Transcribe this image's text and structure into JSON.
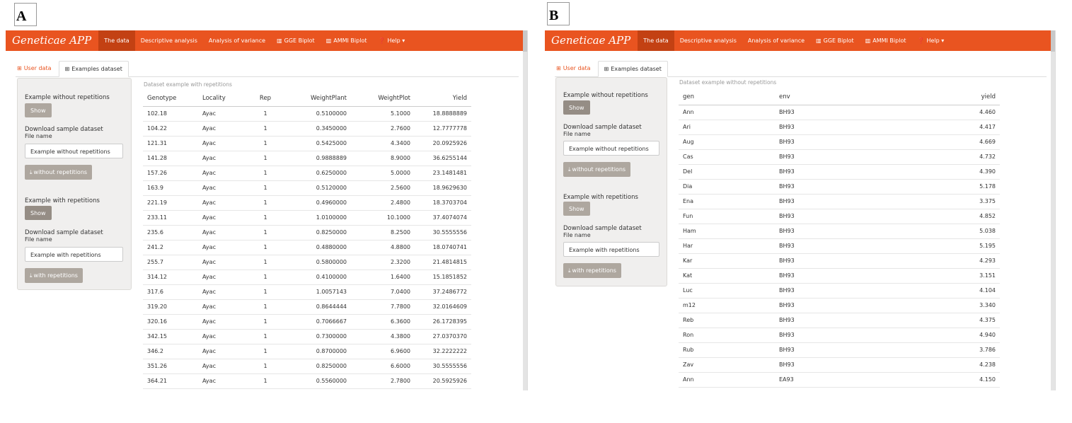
{
  "panel_a": {
    "label": "A",
    "navbar": {
      "brand": "Geneticae APP",
      "items": [
        {
          "label": "The data",
          "icon": ""
        },
        {
          "label": "Descriptive analysis",
          "icon": ""
        },
        {
          "label": "Analysis of variance",
          "icon": ""
        },
        {
          "label": "GGE Biplot",
          "icon": "chart-icon"
        },
        {
          "label": "AMMI Biplot",
          "icon": "chart-icon"
        },
        {
          "label": "Help ▾",
          "icon": "help-icon"
        }
      ]
    },
    "tabs": [
      {
        "label": "User data"
      },
      {
        "label": "Examples dataset"
      }
    ],
    "sidebar": {
      "example_without_label": "Example without repetitions",
      "show_without_label": "Show",
      "download_without_label": "Download sample dataset",
      "filename_without_label": "File name",
      "filename_without_value": "Example without repetitions",
      "download_without_button": "without repetitions",
      "example_with_label": "Example with repetitions",
      "show_with_label": "Show",
      "download_with_label": "Download sample dataset",
      "filename_with_label": "File name",
      "filename_with_value": "Example with repetitions",
      "download_with_button": "with repetitions"
    },
    "table": {
      "caption": "Dataset example with repetitions",
      "columns": [
        "Genotype",
        "Locality",
        "Rep",
        "WeightPlant",
        "WeightPlot",
        "Yield"
      ],
      "rows": [
        [
          "102.18",
          "Ayac",
          "1",
          "0.5100000",
          "5.1000",
          "18.8888889"
        ],
        [
          "104.22",
          "Ayac",
          "1",
          "0.3450000",
          "2.7600",
          "12.7777778"
        ],
        [
          "121.31",
          "Ayac",
          "1",
          "0.5425000",
          "4.3400",
          "20.0925926"
        ],
        [
          "141.28",
          "Ayac",
          "1",
          "0.9888889",
          "8.9000",
          "36.6255144"
        ],
        [
          "157.26",
          "Ayac",
          "1",
          "0.6250000",
          "5.0000",
          "23.1481481"
        ],
        [
          "163.9",
          "Ayac",
          "1",
          "0.5120000",
          "2.5600",
          "18.9629630"
        ],
        [
          "221.19",
          "Ayac",
          "1",
          "0.4960000",
          "2.4800",
          "18.3703704"
        ],
        [
          "233.11",
          "Ayac",
          "1",
          "1.0100000",
          "10.1000",
          "37.4074074"
        ],
        [
          "235.6",
          "Ayac",
          "1",
          "0.8250000",
          "8.2500",
          "30.5555556"
        ],
        [
          "241.2",
          "Ayac",
          "1",
          "0.4880000",
          "4.8800",
          "18.0740741"
        ],
        [
          "255.7",
          "Ayac",
          "1",
          "0.5800000",
          "2.3200",
          "21.4814815"
        ],
        [
          "314.12",
          "Ayac",
          "1",
          "0.4100000",
          "1.6400",
          "15.1851852"
        ],
        [
          "317.6",
          "Ayac",
          "1",
          "1.0057143",
          "7.0400",
          "37.2486772"
        ],
        [
          "319.20",
          "Ayac",
          "1",
          "0.8644444",
          "7.7800",
          "32.0164609"
        ],
        [
          "320.16",
          "Ayac",
          "1",
          "0.7066667",
          "6.3600",
          "26.1728395"
        ],
        [
          "342.15",
          "Ayac",
          "1",
          "0.7300000",
          "4.3800",
          "27.0370370"
        ],
        [
          "346.2",
          "Ayac",
          "1",
          "0.8700000",
          "6.9600",
          "32.2222222"
        ],
        [
          "351.26",
          "Ayac",
          "1",
          "0.8250000",
          "6.6000",
          "30.5555556"
        ],
        [
          "364.21",
          "Ayac",
          "1",
          "0.5560000",
          "2.7800",
          "20.5925926"
        ]
      ]
    }
  },
  "panel_b": {
    "label": "B",
    "navbar": {
      "brand": "Geneticae APP",
      "items": [
        {
          "label": "The data",
          "icon": ""
        },
        {
          "label": "Descriptive analysis",
          "icon": ""
        },
        {
          "label": "Analysis of variance",
          "icon": ""
        },
        {
          "label": "GGE Biplot",
          "icon": "chart-icon"
        },
        {
          "label": "AMMI Biplot",
          "icon": "chart-icon"
        },
        {
          "label": "Help ▾",
          "icon": "help-icon"
        }
      ]
    },
    "tabs": [
      {
        "label": "User data"
      },
      {
        "label": "Examples dataset"
      }
    ],
    "sidebar": {
      "example_without_label": "Example without repetitions",
      "show_without_label": "Show",
      "download_without_label": "Download sample dataset",
      "filename_without_label": "File name",
      "filename_without_value": "Example without repetitions",
      "download_without_button": "without repetitions",
      "example_with_label": "Example with repetitions",
      "show_with_label": "Show",
      "download_with_label": "Download sample dataset",
      "filename_with_label": "File name",
      "filename_with_value": "Example with repetitions",
      "download_with_button": "with repetitions"
    },
    "table": {
      "caption": "Dataset example without repetitions",
      "columns": [
        "gen",
        "env",
        "yield"
      ],
      "rows": [
        [
          "Ann",
          "BH93",
          "4.460"
        ],
        [
          "Ari",
          "BH93",
          "4.417"
        ],
        [
          "Aug",
          "BH93",
          "4.669"
        ],
        [
          "Cas",
          "BH93",
          "4.732"
        ],
        [
          "Del",
          "BH93",
          "4.390"
        ],
        [
          "Dia",
          "BH93",
          "5.178"
        ],
        [
          "Ena",
          "BH93",
          "3.375"
        ],
        [
          "Fun",
          "BH93",
          "4.852"
        ],
        [
          "Ham",
          "BH93",
          "5.038"
        ],
        [
          "Har",
          "BH93",
          "5.195"
        ],
        [
          "Kar",
          "BH93",
          "4.293"
        ],
        [
          "Kat",
          "BH93",
          "3.151"
        ],
        [
          "Luc",
          "BH93",
          "4.104"
        ],
        [
          "m12",
          "BH93",
          "3.340"
        ],
        [
          "Reb",
          "BH93",
          "4.375"
        ],
        [
          "Ron",
          "BH93",
          "4.940"
        ],
        [
          "Rub",
          "BH93",
          "3.786"
        ],
        [
          "Zav",
          "BH93",
          "4.238"
        ],
        [
          "Ann",
          "EA93",
          "4.150"
        ]
      ]
    }
  },
  "colors": {
    "navbar": "#e95420",
    "navbar_active": "#c34113",
    "button": "#aea79f",
    "button_active": "#958d85",
    "sidebar_bg": "#f0efee"
  }
}
